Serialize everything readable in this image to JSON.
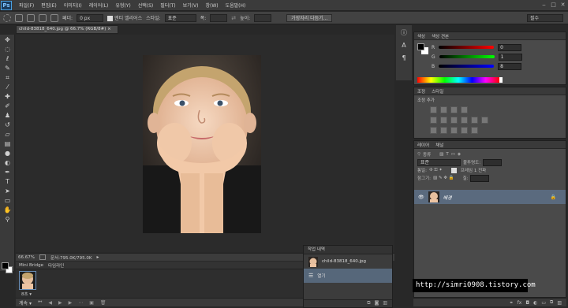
{
  "app": {
    "logo": "Ps"
  },
  "menubar": {
    "items": [
      "파일(F)",
      "편집(E)",
      "이미지(I)",
      "레이어(L)",
      "유형(Y)",
      "선택(S)",
      "필터(T)",
      "보기(V)",
      "창(W)",
      "도움말(H)"
    ]
  },
  "options": {
    "feather_label": "페더:",
    "feather_value": "0 px",
    "antialias_label": "앤티 앨리어스",
    "style_label": "스타일:",
    "style_value": "표준",
    "width_label": "폭:",
    "height_label": "높이:",
    "refine_button": "가장자리 다듬기...",
    "workspace": "필수"
  },
  "document": {
    "tab_title": "child-83818_640.jpg @ 66.7% (RGB/8#)",
    "zoom": "66.67%",
    "doc_size": "문서:795.0K/795.0K"
  },
  "bottom": {
    "tabs": [
      "Mini Bridge",
      "타임라인"
    ],
    "thumb_label": "8초 ▾",
    "loop_label": "계속 ▾"
  },
  "history": {
    "tab": "작업 내역",
    "items": [
      "child-83818_640.jpg",
      "열기"
    ]
  },
  "color_panel": {
    "tabs": [
      "색상",
      "색상 견본"
    ],
    "r_label": "R",
    "g_label": "G",
    "b_label": "B",
    "r": "0",
    "g": "1",
    "b": "8"
  },
  "adjust_panel": {
    "tabs": [
      "조정",
      "스타일"
    ],
    "add_label": "조정 추가"
  },
  "layers_panel": {
    "tabs": [
      "레이어",
      "채널"
    ],
    "kind_label": "종류",
    "blend_mode": "표준",
    "opacity_label": "불투명도:",
    "lock_label": "잠그기:",
    "fill_label": "칠:",
    "unify_label": "통일:",
    "propagate_label": "프레임 1 전파",
    "layer_name": "배경"
  },
  "watermark": "http://simri0908.tistory.com"
}
